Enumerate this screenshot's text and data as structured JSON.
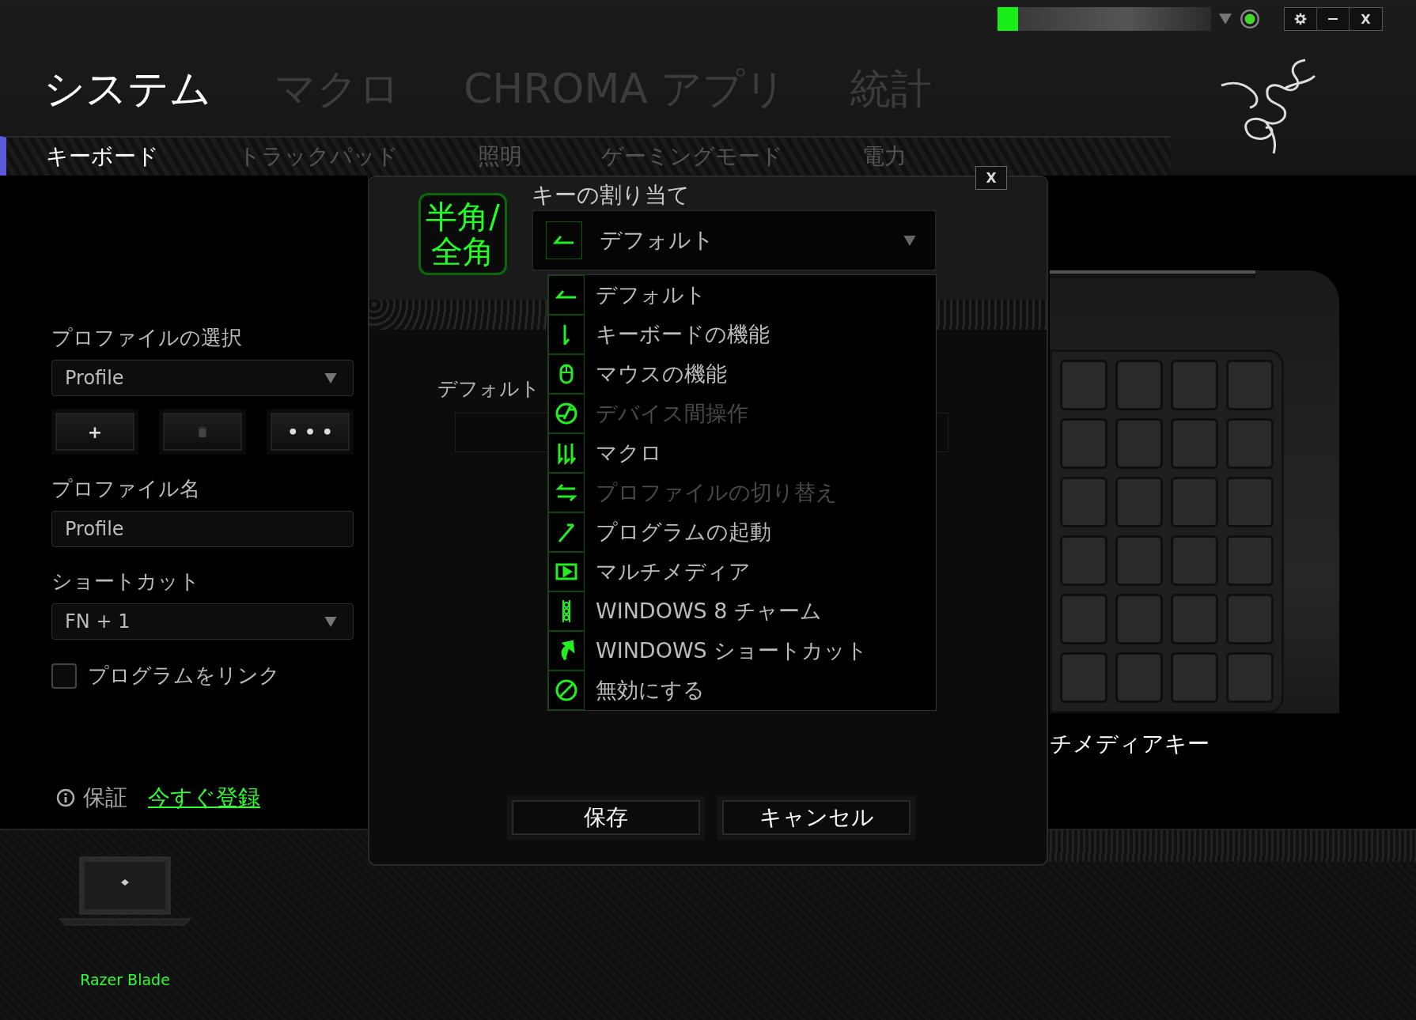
{
  "window_controls": {
    "close": "X"
  },
  "main_tabs": [
    {
      "label": "システム",
      "selected": true
    },
    {
      "label": "マクロ",
      "selected": false
    },
    {
      "label": "CHROMA アプリ",
      "selected": false
    },
    {
      "label": "統計",
      "selected": false
    }
  ],
  "sub_tabs": [
    {
      "label": "キーボード",
      "selected": true
    },
    {
      "label": "トラックパッド",
      "selected": false
    },
    {
      "label": "照明",
      "selected": false
    },
    {
      "label": "ゲーミングモード",
      "selected": false
    },
    {
      "label": "電力",
      "selected": false
    }
  ],
  "sidebar": {
    "profile_select": {
      "label": "プロファイルの選択",
      "value": "Profile"
    },
    "profile_buttons": [
      {
        "kind": "add",
        "text": "+",
        "disabled": false
      },
      {
        "kind": "delete",
        "disabled": true
      },
      {
        "kind": "more",
        "text": "• • •",
        "disabled": false
      }
    ],
    "profile_name": {
      "label": "プロファイル名",
      "value": "Profile"
    },
    "shortcut": {
      "label": "ショートカット",
      "value": "FN + 1"
    },
    "link_program": {
      "label": "プログラムをリンク",
      "checked": false
    },
    "warranty": {
      "label": "保証",
      "link": "今すぐ登録"
    }
  },
  "keyboard_caption": "チメディアキー",
  "device": {
    "name": "Razer Blade"
  },
  "dialog": {
    "close": "X",
    "key_label": [
      "半角/",
      "全角"
    ],
    "assign_label": "キーの割り当て",
    "selected_value": "デフォルト",
    "field_label": "デフォルト",
    "options": [
      {
        "kind": "default",
        "label": "デフォルト",
        "disabled": false
      },
      {
        "kind": "keyboard",
        "label": "キーボードの機能",
        "disabled": false
      },
      {
        "kind": "mouse",
        "label": "マウスの機能",
        "disabled": false
      },
      {
        "kind": "interdevice",
        "label": "デバイス間操作",
        "disabled": true
      },
      {
        "kind": "macro",
        "label": "マクロ",
        "disabled": false
      },
      {
        "kind": "profile-switch",
        "label": "プロファイルの切り替え",
        "disabled": true
      },
      {
        "kind": "launch",
        "label": "プログラムの起動",
        "disabled": false
      },
      {
        "kind": "multimedia",
        "label": "マルチメディア",
        "disabled": false
      },
      {
        "kind": "charms",
        "label": "WINDOWS 8 チャーム",
        "disabled": false
      },
      {
        "kind": "shortcut",
        "label": "WINDOWS ショートカット",
        "disabled": false
      },
      {
        "kind": "disable",
        "label": "無効にする",
        "disabled": false
      }
    ],
    "buttons": [
      "保存",
      "キャンセル"
    ]
  }
}
